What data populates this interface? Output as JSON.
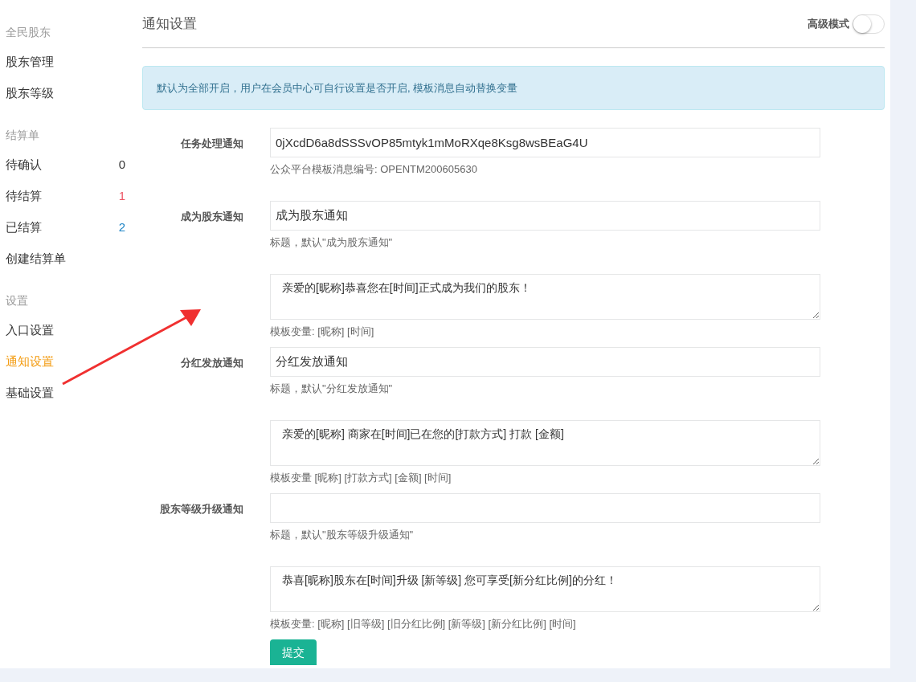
{
  "sidebar": {
    "sections": [
      {
        "heading": "全民股东",
        "items": [
          {
            "label": "股东管理",
            "selected": false
          },
          {
            "label": "股东等级",
            "selected": false
          }
        ]
      },
      {
        "heading": "结算单",
        "items": [
          {
            "label": "待确认",
            "count": "0",
            "color": "#333333",
            "selected": false
          },
          {
            "label": "待结算",
            "count": "1",
            "color": "#ed5565",
            "selected": false
          },
          {
            "label": "已结算",
            "count": "2",
            "color": "#1c84c6",
            "selected": false
          },
          {
            "label": "创建结算单",
            "selected": false
          }
        ]
      },
      {
        "heading": "设置",
        "items": [
          {
            "label": "入口设置",
            "selected": false
          },
          {
            "label": "通知设置",
            "selected": true
          },
          {
            "label": "基础设置",
            "selected": false
          }
        ]
      }
    ]
  },
  "header": {
    "title": "通知设置",
    "advanced_mode": {
      "label": "高级模式",
      "on": false
    }
  },
  "alert": "默认为全部开启，用户在会员中心可自行设置是否开启, 模板消息自动替换变量",
  "form": {
    "groups": [
      {
        "label": "任务处理通知",
        "kind": "input",
        "value": "0jXcdD6a8dSSSvOP85mtyk1mMoRXqe8Ksg8wsBEaG4U",
        "help": "公众平台模板消息编号: OPENTM200605630"
      },
      {
        "label": "成为股东通知",
        "kind": "input",
        "value": "成为股东通知",
        "help": "标题，默认\"成为股东通知\""
      },
      {
        "kind": "textarea",
        "value": "亲爱的[昵称]恭喜您在[时间]正式成为我们的股东！",
        "help": "模板变量: [昵称] [时间]"
      },
      {
        "label": "分红发放通知",
        "kind": "input",
        "value": "分红发放通知",
        "help": "标题，默认\"分红发放通知\""
      },
      {
        "kind": "textarea",
        "value": "亲爱的[昵称] 商家在[时间]已在您的[打款方式] 打款 [金额]",
        "help": "模板变量 [昵称] [打款方式] [金额] [时间]"
      },
      {
        "label": "股东等级升级通知",
        "kind": "input",
        "help": "标题，默认\"股东等级升级通知\""
      },
      {
        "kind": "textarea",
        "value": "恭喜[昵称]股东在[时间]升级 [新等级] 您可享受[新分红比例]的分红！",
        "help": "模板变量: [昵称] [旧等级] [旧分红比例] [新等级] [新分红比例] [时间]"
      }
    ],
    "submit": "提交"
  }
}
